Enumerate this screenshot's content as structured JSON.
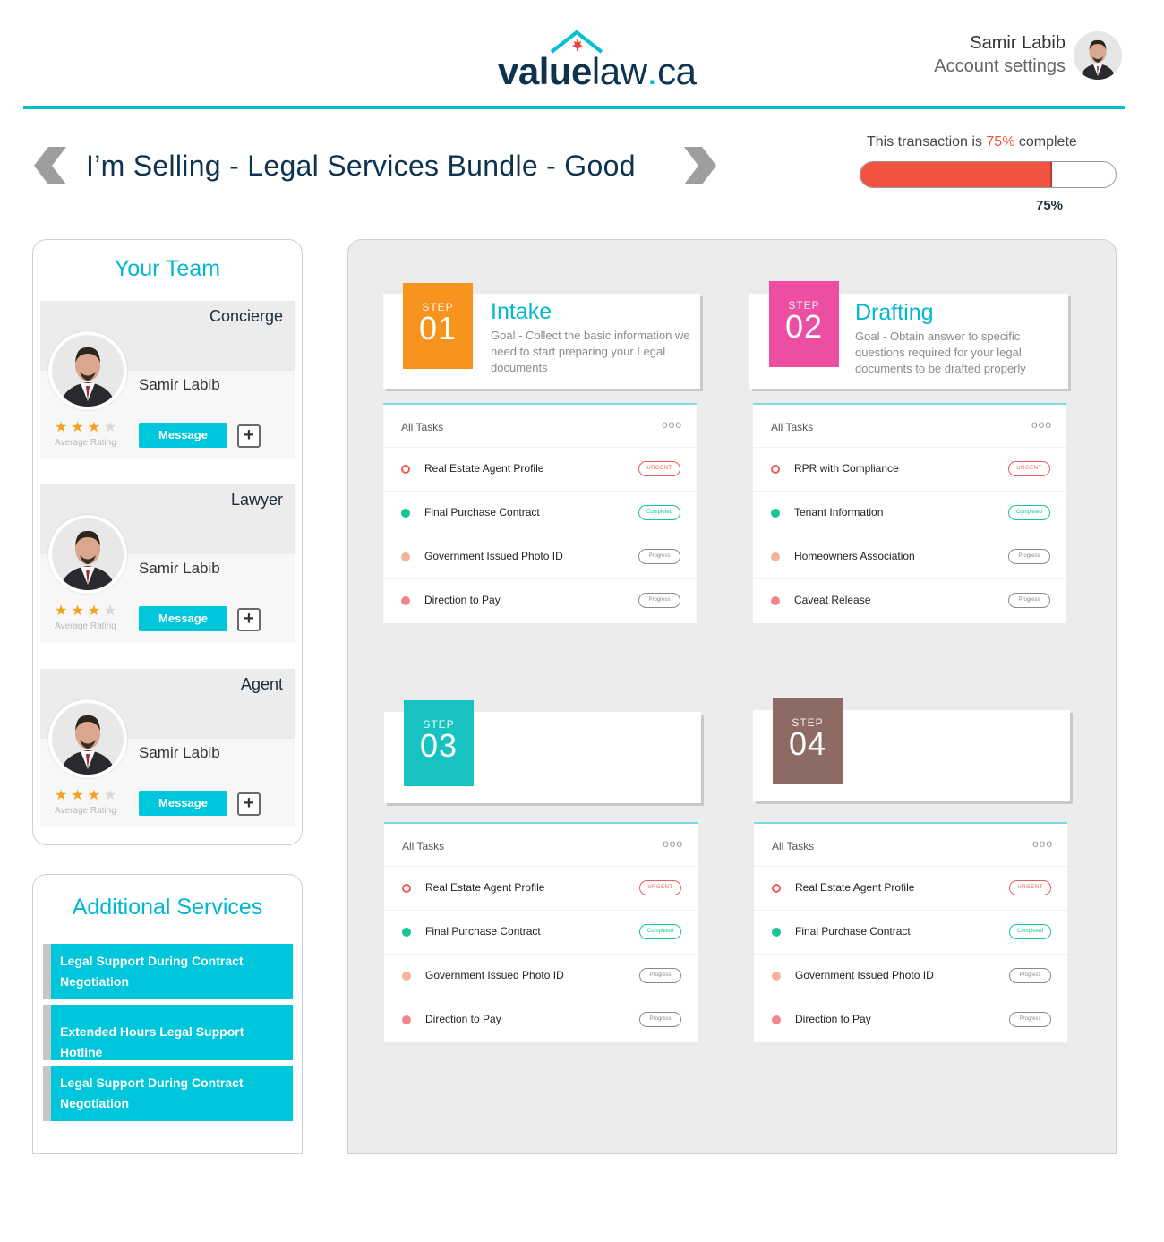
{
  "header": {
    "logo": {
      "part1": "value",
      "part2": "law",
      "part3": ".",
      "part4": "ca"
    },
    "user_name": "Samir Labib",
    "account_link": "Account settings"
  },
  "title_bar": {
    "title": "I’m Selling - Legal Services Bundle - Good"
  },
  "progress": {
    "caption_prefix": "This transaction is ",
    "caption_pct": "75%",
    "caption_suffix": " complete",
    "value_percent": 75,
    "label": "75%",
    "fill_color": "#f05340"
  },
  "team": {
    "title": "Your Team",
    "rating_caption": "Average Rating",
    "message_label": "Message",
    "add_label": "+",
    "members": [
      {
        "role": "Concierge",
        "name": "Samir Labib",
        "rating": 3,
        "rating_max": 4
      },
      {
        "role": "Lawyer",
        "name": "Samir Labib",
        "rating": 3,
        "rating_max": 4
      },
      {
        "role": "Agent",
        "name": "Samir Labib",
        "rating": 3,
        "rating_max": 4
      }
    ]
  },
  "services": {
    "title": "Additional Services",
    "items": [
      "Legal Support During Contract Negotiation",
      "Extended Hours Legal Support Hotline",
      "Legal Support During Contract Negotiation"
    ]
  },
  "steps": [
    {
      "step_label": "STEP",
      "number": "01",
      "color": "#f7941d",
      "title": "Intake",
      "goal": "Goal - Collect the basic information we need to start preparing your Legal documents",
      "tasks_header": "All Tasks",
      "more": "ooo",
      "tasks": [
        {
          "name": "Real Estate Agent Profile",
          "status": "URGENT"
        },
        {
          "name": "Final Purchase Contract",
          "status": "Completed"
        },
        {
          "name": "Government Issued Photo ID",
          "status": "Progress"
        },
        {
          "name": "Direction to Pay",
          "status": "Progress"
        }
      ]
    },
    {
      "step_label": "STEP",
      "number": "02",
      "color": "#ec4fa1",
      "title": "Drafting",
      "goal": "Goal - Obtain answer to specific questions required for your legal documents to be drafted properly",
      "tasks_header": "All Tasks",
      "more": "ooo",
      "tasks": [
        {
          "name": "RPR with Compliance",
          "status": "URGENT"
        },
        {
          "name": "Tenant Information",
          "status": "Completed"
        },
        {
          "name": "Homeowners Association",
          "status": "Progress"
        },
        {
          "name": "Caveat Release",
          "status": "Progress"
        }
      ]
    },
    {
      "step_label": "STEP",
      "number": "03",
      "color": "#16c3c1",
      "title": "",
      "goal": "",
      "tasks_header": "All Tasks",
      "more": "ooo",
      "tasks": [
        {
          "name": "Real Estate Agent Profile",
          "status": "URGENT"
        },
        {
          "name": "Final Purchase Contract",
          "status": "Completed"
        },
        {
          "name": "Government Issued Photo ID",
          "status": "Progress"
        },
        {
          "name": "Direction to Pay",
          "status": "Progress"
        }
      ]
    },
    {
      "step_label": "STEP",
      "number": "04",
      "color": "#8d6a63",
      "title": "",
      "goal": "",
      "tasks_header": "All Tasks",
      "more": "ooo",
      "tasks": [
        {
          "name": "Real Estate Agent Profile",
          "status": "URGENT"
        },
        {
          "name": "Final Purchase Contract",
          "status": "Completed"
        },
        {
          "name": "Government Issued Photo ID",
          "status": "Progress"
        },
        {
          "name": "Direction to Pay",
          "status": "Progress"
        }
      ]
    }
  ],
  "colors": {
    "accent": "#00bfd0",
    "button": "#00c6dc",
    "urgent": "#f05a5a",
    "completed": "#14c896",
    "star": "#f6a01a"
  },
  "icons": [
    "chevron-left-icon",
    "chevron-right-icon",
    "house-roof-icon",
    "maple-leaf-icon",
    "avatar",
    "star-icon",
    "plus-icon",
    "more-icon"
  ]
}
